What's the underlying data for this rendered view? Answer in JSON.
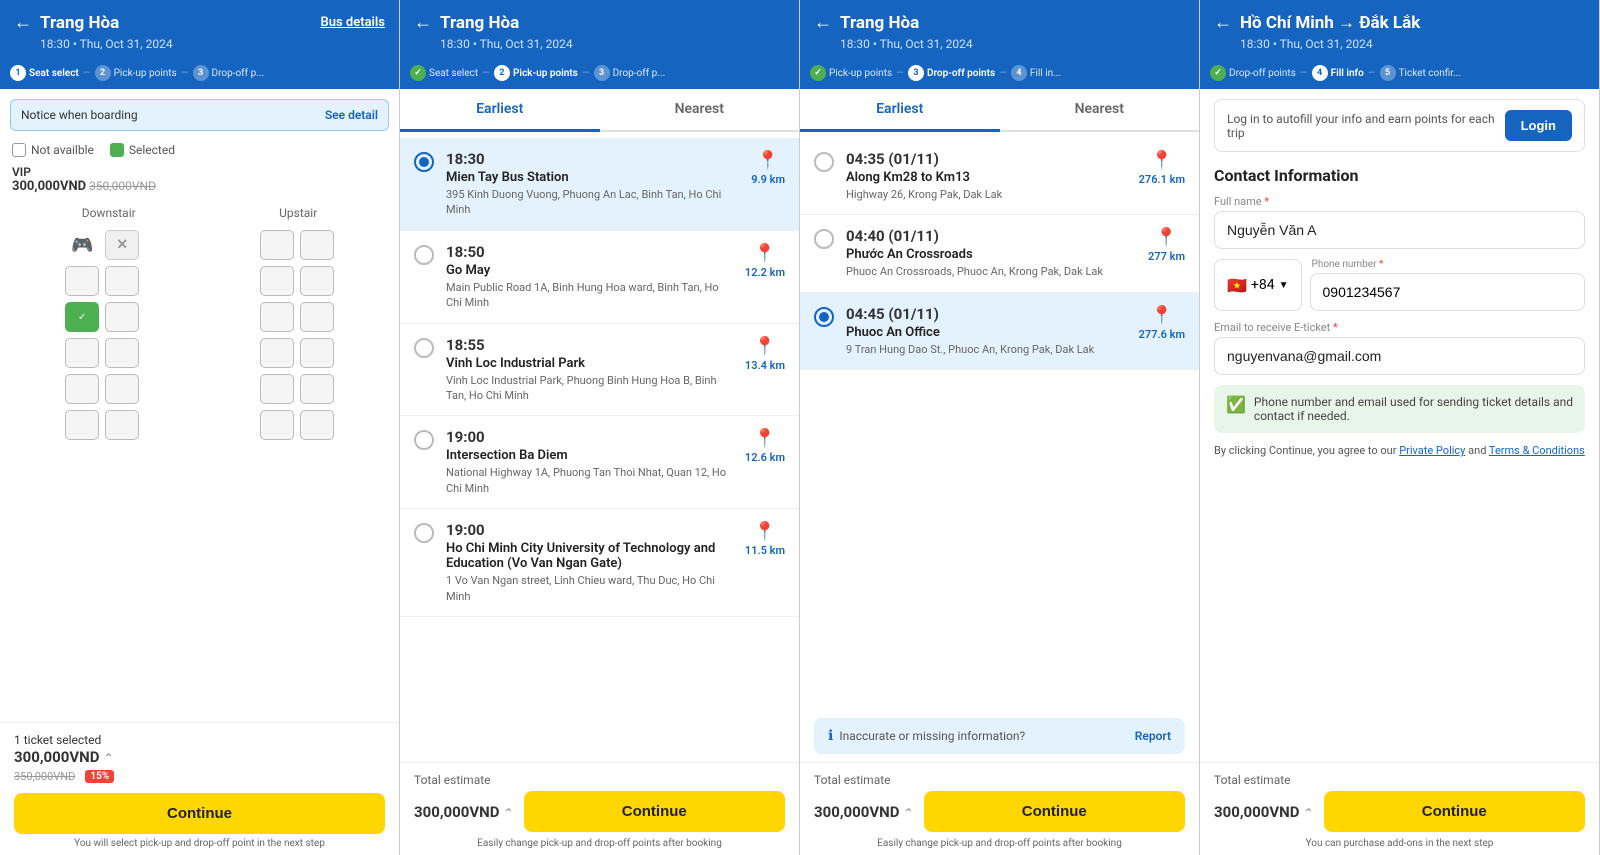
{
  "panels": [
    {
      "id": "panel1",
      "header": {
        "title": "Trang Hòa",
        "subtitle": "18:30 • Thu, Oct 31, 2024",
        "bus_details_label": "Bus details",
        "back": true
      },
      "steps": [
        {
          "num": "1",
          "label": "Seat select",
          "state": "active"
        },
        {
          "sep": "—"
        },
        {
          "num": "2",
          "label": "Pick-up points",
          "state": "inactive"
        },
        {
          "sep": "—"
        },
        {
          "num": "3",
          "label": "Drop-off p...",
          "state": "inactive"
        }
      ],
      "notice": {
        "text": "Notice when boarding",
        "see_detail": "See detail"
      },
      "legend": {
        "not_available": "Not availble",
        "selected": "Selected"
      },
      "vip": {
        "label": "VIP",
        "price": "300,000VND",
        "price_old": "350,000VND"
      },
      "floors": [
        "Downstair",
        "Upstair"
      ],
      "footer": {
        "tickets": "1 ticket selected",
        "price": "300,000VND",
        "price_old": "350,000VND",
        "discount": "15%",
        "continue": "Continue",
        "hint": "You will select pick-up and drop-off point in the next step"
      }
    },
    {
      "id": "panel2",
      "header": {
        "title": "Trang Hòa",
        "subtitle": "18:30 • Thu, Oct 31, 2024",
        "back": true
      },
      "steps": [
        {
          "num": "✓",
          "label": "Seat select",
          "state": "done"
        },
        {
          "sep": "—"
        },
        {
          "num": "2",
          "label": "Pick-up points",
          "state": "active"
        },
        {
          "sep": "—"
        },
        {
          "num": "3",
          "label": "Drop-off p...",
          "state": "inactive"
        }
      ],
      "tabs": [
        {
          "label": "Earliest",
          "active": true
        },
        {
          "label": "Nearest",
          "active": false
        }
      ],
      "stops": [
        {
          "selected": true,
          "time": "18:30",
          "name": "Mien Tay Bus Station",
          "address": "395 Kinh Duong Vuong, Phuong An Lac, Binh Tan, Ho Chi Minh",
          "distance": "9.9 km"
        },
        {
          "selected": false,
          "time": "18:50",
          "name": "Go May",
          "address": "Main Public Road 1A, Binh Hung Hoa ward, Binh Tan, Ho Chi Minh",
          "distance": "12.2 km"
        },
        {
          "selected": false,
          "time": "18:55",
          "name": "Vinh Loc Industrial Park",
          "address": "Vinh Loc Industrial Park, Phuong Binh Hung Hoa B, Binh Tan, Ho Chi Minh",
          "distance": "13.4 km"
        },
        {
          "selected": false,
          "time": "19:00",
          "name": "Intersection Ba Diem",
          "address": "National Highway 1A, Phuong Tan Thoi Nhat, Quan 12, Ho Chi Minh",
          "distance": "12.6 km"
        },
        {
          "selected": false,
          "time": "19:00",
          "name": "Ho Chi Minh City University of Technology and Education (Vo Van Ngan Gate)",
          "address": "1 Vo Van Ngan street, Linh Chieu ward, Thu Duc, Ho Chi Minh",
          "distance": "11.5 km"
        }
      ],
      "footer": {
        "total_estimate": "Total estimate",
        "price": "300,000VND",
        "continue": "Continue",
        "hint": "Easily change pick-up and drop-off points after booking"
      }
    },
    {
      "id": "panel3",
      "header": {
        "title": "Trang Hòa",
        "subtitle": "18:30 • Thu, Oct 31, 2024",
        "back": true
      },
      "steps": [
        {
          "num": "✓",
          "label": "Pick-up points",
          "state": "done"
        },
        {
          "sep": "—"
        },
        {
          "num": "3",
          "label": "Drop-off points",
          "state": "active"
        },
        {
          "sep": "—"
        },
        {
          "num": "4",
          "label": "Fill in...",
          "state": "inactive"
        }
      ],
      "tabs": [
        {
          "label": "Earliest",
          "active": true
        },
        {
          "label": "Nearest",
          "active": false
        }
      ],
      "stops": [
        {
          "selected": false,
          "time": "04:35 (01/11)",
          "name": "Along Km28 to Km13",
          "address": "Highway 26, Krong Pak, Dak Lak",
          "distance": "276.1 km"
        },
        {
          "selected": false,
          "time": "04:40 (01/11)",
          "name": "Phước An Crossroads",
          "address": "Phuoc An Crossroads, Phuoc An, Krong Pak, Dak Lak",
          "distance": "277 km"
        },
        {
          "selected": true,
          "time": "04:45 (01/11)",
          "name": "Phuoc An Office",
          "address": "9 Tran Hung Dao St., Phuoc An, Krong Pak, Dak Lak",
          "distance": "277.6 km"
        }
      ],
      "report": {
        "text": "Inaccurate or missing information?",
        "link": "Report"
      },
      "footer": {
        "total_estimate": "Total estimate",
        "price": "300,000VND",
        "continue": "Continue",
        "hint": "Easily change pick-up and drop-off points after booking"
      }
    },
    {
      "id": "panel4",
      "header": {
        "title": "Hồ Chí Minh → Đắk Lắk",
        "subtitle": "18:30 • Thu, Oct 31, 2024",
        "back": true
      },
      "steps": [
        {
          "num": "✓",
          "label": "Drop-off points",
          "state": "done"
        },
        {
          "sep": "—"
        },
        {
          "num": "4",
          "label": "Fill info",
          "state": "active"
        },
        {
          "sep": "—"
        },
        {
          "num": "5",
          "label": "Ticket confir...",
          "state": "inactive"
        }
      ],
      "autofill": {
        "text": "Log in to autofill your info and earn points for each trip",
        "login": "Login"
      },
      "contact": {
        "title": "Contact Information",
        "fullname_label": "Full name *",
        "fullname_value": "Nguyễn Văn A",
        "phone_label": "Phone number *",
        "phone_prefix": "+84",
        "phone_flag": "🇻🇳",
        "phone_value": "0901234567",
        "email_label": "Email to receive E-ticket *",
        "email_value": "nguyenvana@gmail.com",
        "notice": "Phone number and email used for sending ticket details and contact if needed.",
        "terms_text": "By clicking Continue, you agree to our",
        "privacy_link": "Private Policy",
        "terms_and": "and",
        "terms_link": "Terms & Conditions"
      },
      "footer": {
        "total_estimate": "Total estimate",
        "price": "300,000VND",
        "continue": "Continue",
        "hint": "You can purchase add-ons in the next step"
      }
    }
  ]
}
